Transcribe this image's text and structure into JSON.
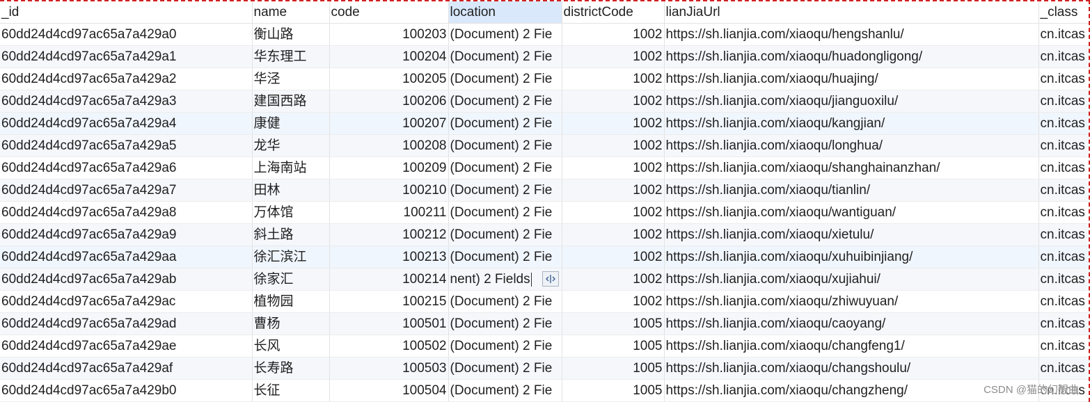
{
  "columns": [
    "_id",
    "name",
    "code",
    "location",
    "districtCode",
    "lianJiaUrl",
    "_class"
  ],
  "selected_column": "location",
  "rows": [
    {
      "id": "60dd24d4cd97ac65a7a429a0",
      "name": "衡山路",
      "code": "100203",
      "location": "(Document) 2 Fie",
      "districtCode": "1002",
      "url": "https://sh.lianjia.com/xiaoqu/hengshanlu/",
      "cls": "cn.itcas"
    },
    {
      "id": "60dd24d4cd97ac65a7a429a1",
      "name": "华东理工",
      "code": "100204",
      "location": "(Document) 2 Fie",
      "districtCode": "1002",
      "url": "https://sh.lianjia.com/xiaoqu/huadongligong/",
      "cls": "cn.itcas"
    },
    {
      "id": "60dd24d4cd97ac65a7a429a2",
      "name": "华泾",
      "code": "100205",
      "location": "(Document) 2 Fie",
      "districtCode": "1002",
      "url": "https://sh.lianjia.com/xiaoqu/huajing/",
      "cls": "cn.itcas"
    },
    {
      "id": "60dd24d4cd97ac65a7a429a3",
      "name": "建国西路",
      "code": "100206",
      "location": "(Document) 2 Fie",
      "districtCode": "1002",
      "url": "https://sh.lianjia.com/xiaoqu/jianguoxilu/",
      "cls": "cn.itcas"
    },
    {
      "id": "60dd24d4cd97ac65a7a429a4",
      "name": "康健",
      "code": "100207",
      "location": "(Document) 2 Fie",
      "districtCode": "1002",
      "url": "https://sh.lianjia.com/xiaoqu/kangjian/",
      "cls": "cn.itcas"
    },
    {
      "id": "60dd24d4cd97ac65a7a429a5",
      "name": "龙华",
      "code": "100208",
      "location": "(Document) 2 Fie",
      "districtCode": "1002",
      "url": "https://sh.lianjia.com/xiaoqu/longhua/",
      "cls": "cn.itcas"
    },
    {
      "id": "60dd24d4cd97ac65a7a429a6",
      "name": "上海南站",
      "code": "100209",
      "location": "(Document) 2 Fie",
      "districtCode": "1002",
      "url": "https://sh.lianjia.com/xiaoqu/shanghainanzhan/",
      "cls": "cn.itcas"
    },
    {
      "id": "60dd24d4cd97ac65a7a429a7",
      "name": "田林",
      "code": "100210",
      "location": "(Document) 2 Fie",
      "districtCode": "1002",
      "url": "https://sh.lianjia.com/xiaoqu/tianlin/",
      "cls": "cn.itcas"
    },
    {
      "id": "60dd24d4cd97ac65a7a429a8",
      "name": "万体馆",
      "code": "100211",
      "location": "(Document) 2 Fie",
      "districtCode": "1002",
      "url": "https://sh.lianjia.com/xiaoqu/wantiguan/",
      "cls": "cn.itcas"
    },
    {
      "id": "60dd24d4cd97ac65a7a429a9",
      "name": "斜土路",
      "code": "100212",
      "location": "(Document) 2 Fie",
      "districtCode": "1002",
      "url": "https://sh.lianjia.com/xiaoqu/xietulu/",
      "cls": "cn.itcas"
    },
    {
      "id": "60dd24d4cd97ac65a7a429aa",
      "name": "徐汇滨江",
      "code": "100213",
      "location": "(Document) 2 Fie",
      "districtCode": "1002",
      "url": "https://sh.lianjia.com/xiaoqu/xuhuibinjiang/",
      "cls": "cn.itcas"
    },
    {
      "id": "60dd24d4cd97ac65a7a429ab",
      "name": "徐家汇",
      "code": "100214",
      "location": "nent) 2 Fields",
      "districtCode": "1002",
      "url": "https://sh.lianjia.com/xiaoqu/xujiahui/",
      "cls": "cn.itcas",
      "editing": true
    },
    {
      "id": "60dd24d4cd97ac65a7a429ac",
      "name": "植物园",
      "code": "100215",
      "location": "(Document) 2 Fie",
      "districtCode": "1002",
      "url": "https://sh.lianjia.com/xiaoqu/zhiwuyuan/",
      "cls": "cn.itcas"
    },
    {
      "id": "60dd24d4cd97ac65a7a429ad",
      "name": "曹杨",
      "code": "100501",
      "location": "(Document) 2 Fie",
      "districtCode": "1005",
      "url": "https://sh.lianjia.com/xiaoqu/caoyang/",
      "cls": "cn.itcas"
    },
    {
      "id": "60dd24d4cd97ac65a7a429ae",
      "name": "长风",
      "code": "100502",
      "location": "(Document) 2 Fie",
      "districtCode": "1005",
      "url": "https://sh.lianjia.com/xiaoqu/changfeng1/",
      "cls": "cn.itcas"
    },
    {
      "id": "60dd24d4cd97ac65a7a429af",
      "name": "长寿路",
      "code": "100503",
      "location": "(Document) 2 Fie",
      "districtCode": "1005",
      "url": "https://sh.lianjia.com/xiaoqu/changshoulu/",
      "cls": "cn.itcas"
    },
    {
      "id": "60dd24d4cd97ac65a7a429b0",
      "name": "长征",
      "code": "100504",
      "location": "(Document) 2 Fie",
      "districtCode": "1005",
      "url": "https://sh.lianjia.com/xiaoqu/changzheng/",
      "cls": "cn.itcas"
    }
  ],
  "highlighted_rows": [
    4,
    10
  ],
  "watermark": "CSDN @猫的幻想曲",
  "icons": {
    "expand": "expand-horizontal-icon"
  }
}
